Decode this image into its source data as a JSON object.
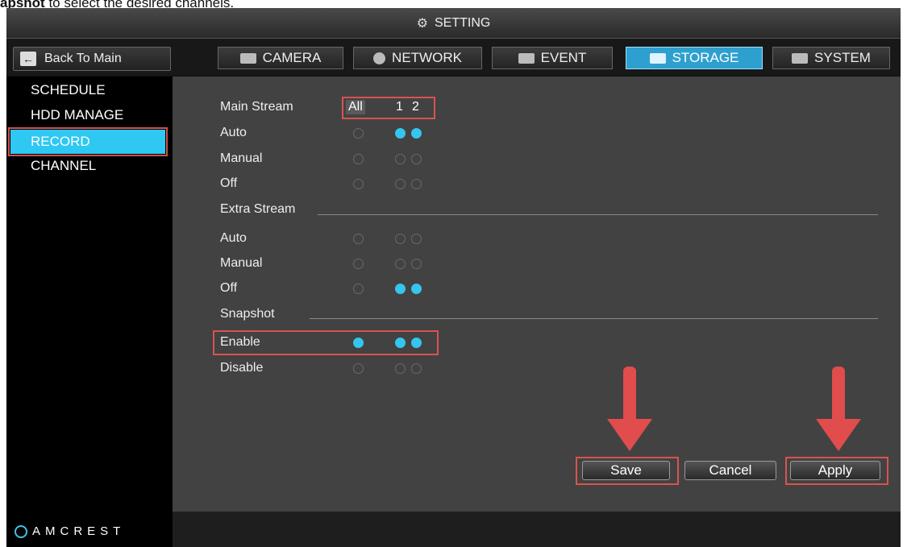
{
  "caption": {
    "bold": "apshot",
    "rest": " to select the desired channels."
  },
  "title": "SETTING",
  "nav": {
    "back": "Back To Main",
    "tabs": [
      "CAMERA",
      "NETWORK",
      "EVENT",
      "STORAGE",
      "SYSTEM"
    ],
    "active_tab": "STORAGE"
  },
  "sidebar": {
    "items": [
      "SCHEDULE",
      "HDD MANAGE",
      "RECORD",
      "CHANNEL"
    ],
    "active": "RECORD"
  },
  "brand": "AMCREST",
  "record": {
    "main_stream": {
      "label": "Main Stream",
      "columns": [
        "All",
        "1",
        "2"
      ],
      "rows": [
        {
          "label": "Auto",
          "selected": [
            false,
            true,
            true
          ]
        },
        {
          "label": "Manual",
          "selected": [
            false,
            false,
            false
          ]
        },
        {
          "label": "Off",
          "selected": [
            false,
            false,
            false
          ]
        }
      ]
    },
    "extra_stream": {
      "label": "Extra Stream",
      "rows": [
        {
          "label": "Auto",
          "selected": [
            false,
            false,
            false
          ]
        },
        {
          "label": "Manual",
          "selected": [
            false,
            false,
            false
          ]
        },
        {
          "label": "Off",
          "selected": [
            false,
            true,
            true
          ]
        }
      ]
    },
    "snapshot": {
      "label": "Snapshot",
      "rows": [
        {
          "label": "Enable",
          "selected": [
            true,
            true,
            true
          ]
        },
        {
          "label": "Disable",
          "selected": [
            false,
            false,
            false
          ]
        }
      ]
    }
  },
  "buttons": {
    "save": "Save",
    "cancel": "Cancel",
    "apply": "Apply"
  },
  "colors": {
    "accent": "#2ec8f2",
    "highlight_box": "#d9534f",
    "arrow": "#e14c4c"
  }
}
